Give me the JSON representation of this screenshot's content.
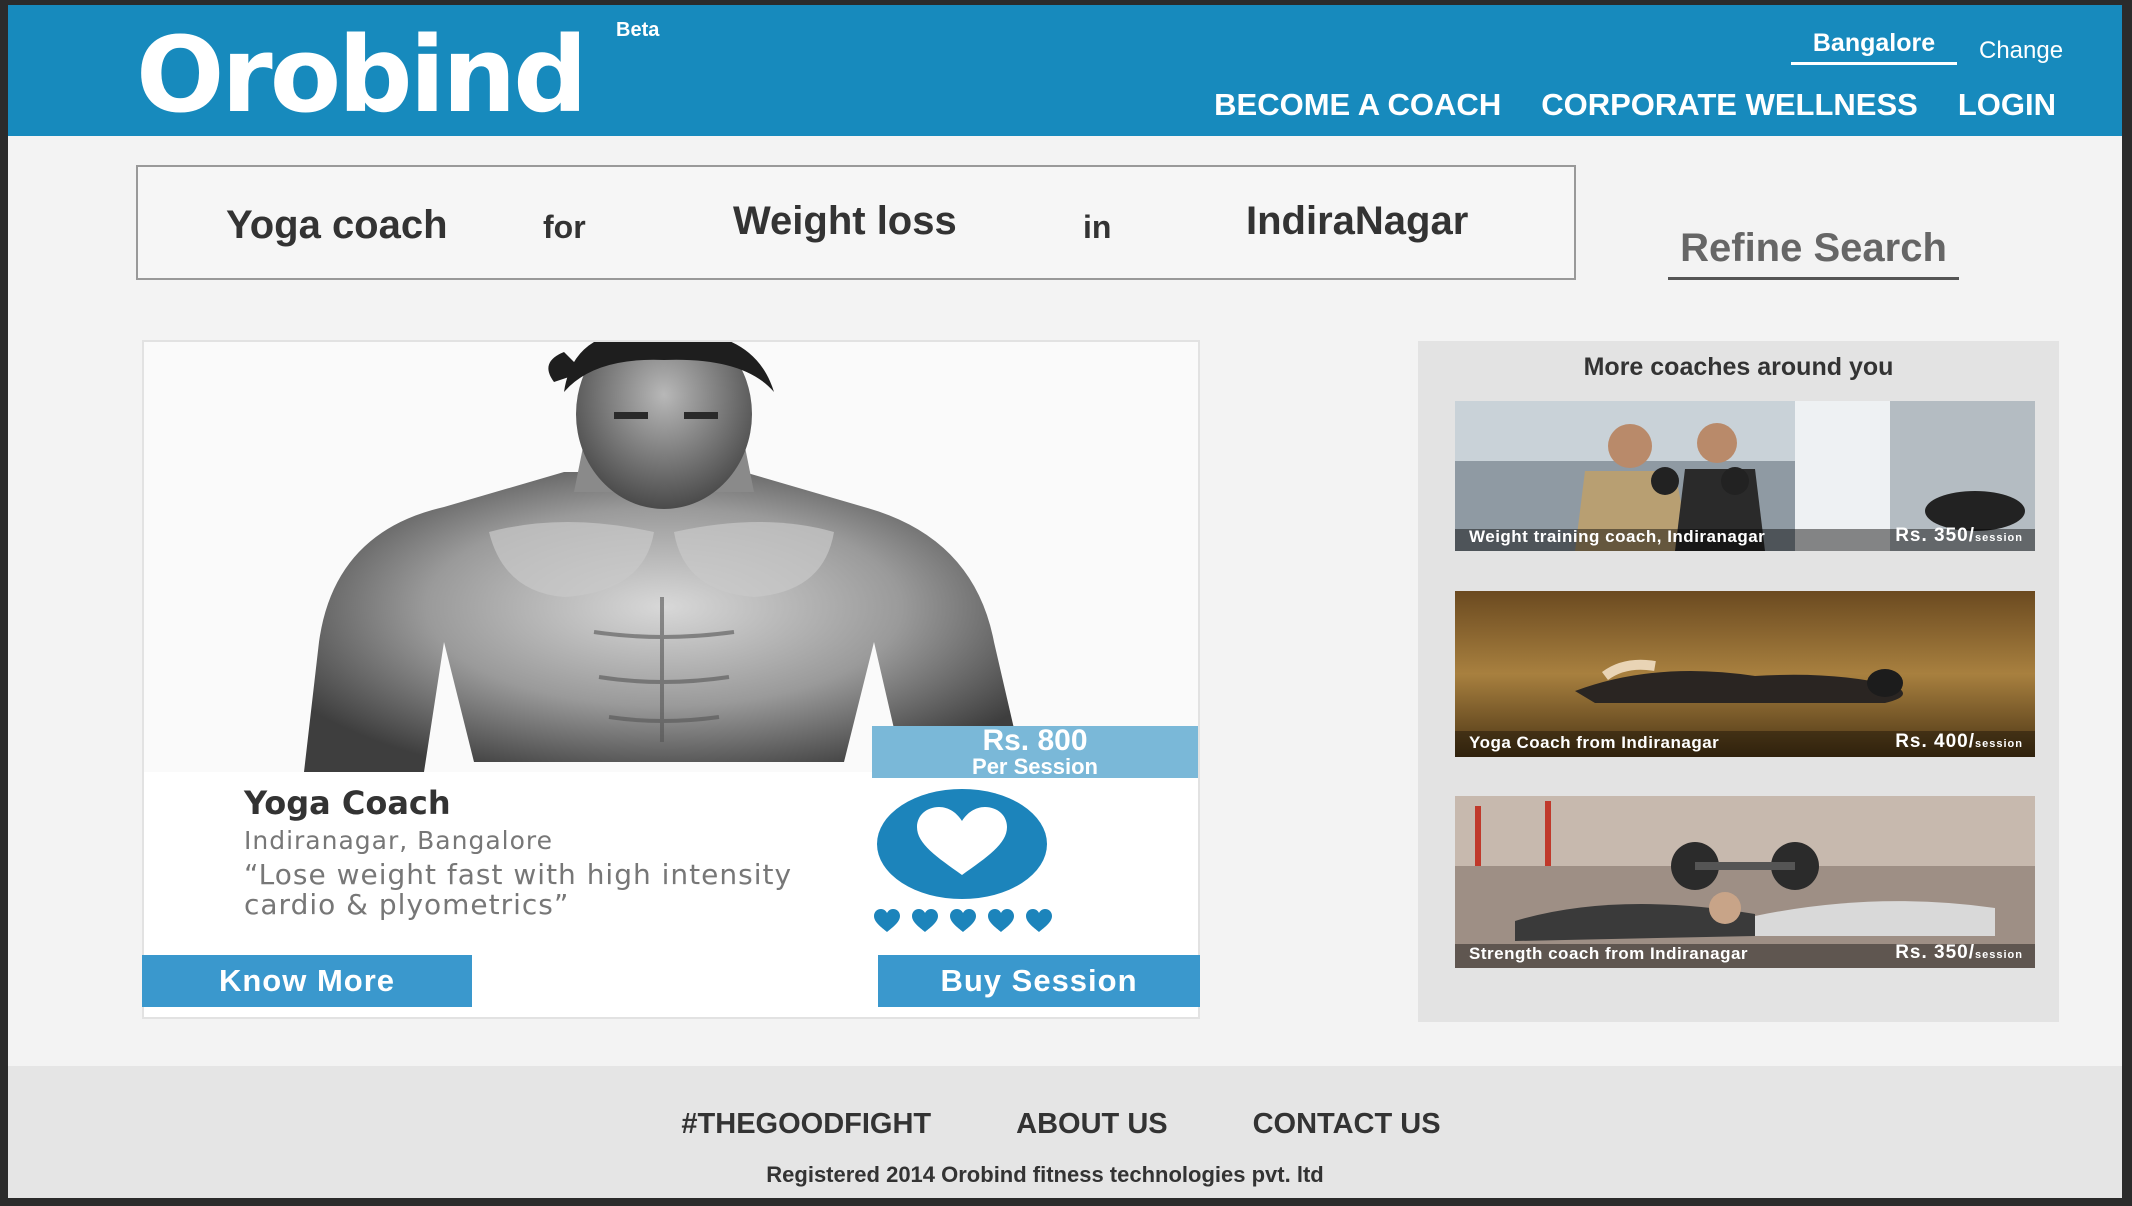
{
  "header": {
    "logo": "Orobind",
    "badge": "Beta",
    "city": "Bangalore",
    "change_label": "Change",
    "nav": [
      "BECOME A COACH",
      "CORPORATE WELLNESS",
      "LOGIN"
    ]
  },
  "search": {
    "coach_type": "Yoga coach",
    "for_label": "for",
    "goal": "Weight loss",
    "in_label": "in",
    "location": "IndiraNagar",
    "refine_label": "Refine Search"
  },
  "featured": {
    "price": "Rs. 800",
    "price_unit": "Per Session",
    "title": "Yoga Coach",
    "location": "Indiranagar, Bangalore",
    "quote": "“Lose weight fast with high intensity cardio & plyometrics”",
    "rating_hearts": 5,
    "know_more_label": "Know More",
    "buy_label": "Buy Session"
  },
  "more_coaches": {
    "title": "More coaches around you",
    "items": [
      {
        "caption": "Weight training coach, Indiranagar",
        "price": "Rs. 350/",
        "unit": "session"
      },
      {
        "caption": "Yoga Coach from Indiranagar",
        "price": "Rs. 400/",
        "unit": "session"
      },
      {
        "caption": "Strength coach from Indiranagar",
        "price": "Rs. 350/",
        "unit": "session"
      }
    ]
  },
  "footer": {
    "links": [
      "#THEGOODFIGHT",
      "ABOUT US",
      "CONTACT US"
    ],
    "copyright": "Registered 2014 Orobind fitness technologies pvt. ltd"
  },
  "colors": {
    "brand_blue": "#178abd",
    "button_blue": "#3a98cd",
    "price_tag": "#7ab8d8"
  }
}
